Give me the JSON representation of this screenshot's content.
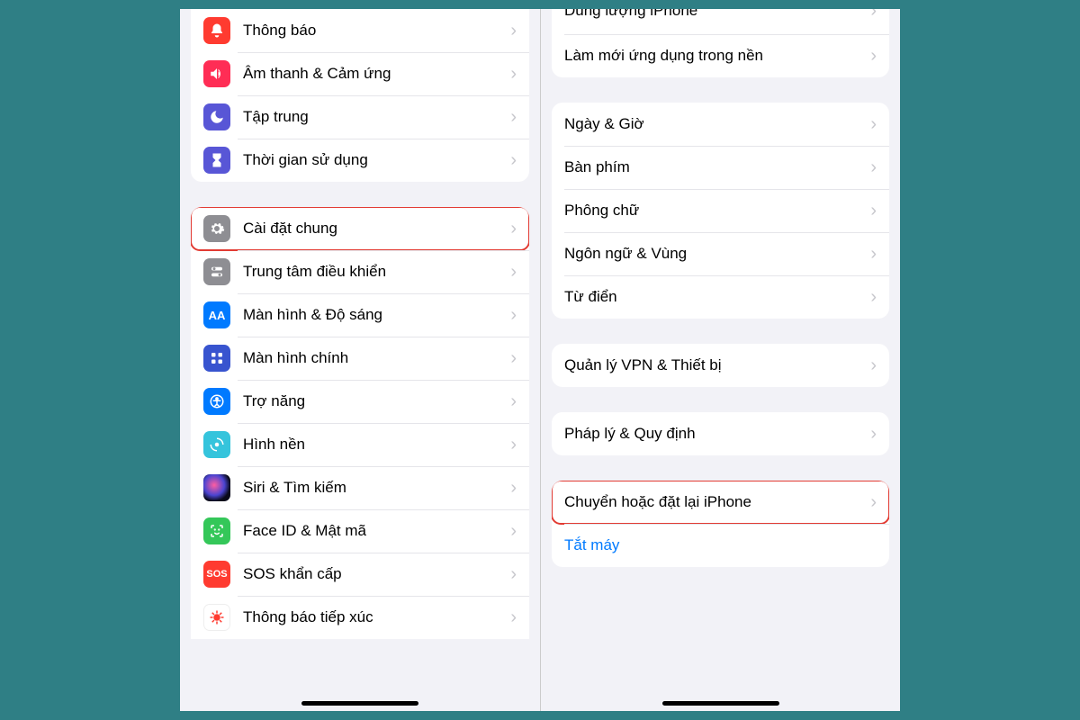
{
  "left": {
    "group1": [
      {
        "id": "notifications",
        "label": "Thông báo",
        "icon": "bell",
        "color": "#ff3b30"
      },
      {
        "id": "sounds",
        "label": "Âm thanh & Cảm ứng",
        "icon": "sound",
        "color": "#ff2d55"
      },
      {
        "id": "focus",
        "label": "Tập trung",
        "icon": "moon",
        "color": "#5856d6"
      },
      {
        "id": "screentime",
        "label": "Thời gian sử dụng",
        "icon": "hourglass",
        "color": "#5856d6"
      }
    ],
    "group2": [
      {
        "id": "general",
        "label": "Cài đặt chung",
        "icon": "gear",
        "color": "#8e8e93",
        "highlight": true
      },
      {
        "id": "control-center",
        "label": "Trung tâm điều khiển",
        "icon": "toggles",
        "color": "#8e8e93"
      },
      {
        "id": "display",
        "label": "Màn hình & Độ sáng",
        "icon": "aa",
        "color": "#007aff"
      },
      {
        "id": "home-screen",
        "label": "Màn hình chính",
        "icon": "grid",
        "color": "#3854cf"
      },
      {
        "id": "accessibility",
        "label": "Trợ năng",
        "icon": "access",
        "color": "#007aff"
      },
      {
        "id": "wallpaper",
        "label": "Hình nền",
        "icon": "wallpaper",
        "color": "#35c4dc"
      },
      {
        "id": "siri",
        "label": "Siri & Tìm kiếm",
        "icon": "siri",
        "color": "#000"
      },
      {
        "id": "faceid",
        "label": "Face ID & Mật mã",
        "icon": "face",
        "color": "#34c759"
      },
      {
        "id": "sos",
        "label": "SOS khẩn cấp",
        "icon": "sos",
        "color": "#ff3b30"
      },
      {
        "id": "exposure",
        "label": "Thông báo tiếp xúc",
        "icon": "covid",
        "color": "#fff"
      }
    ]
  },
  "right": {
    "truncated_top": "Dung lượng iPhone",
    "group1": [
      {
        "id": "bg-refresh",
        "label": "Làm mới ứng dụng trong nền"
      }
    ],
    "group2": [
      {
        "id": "date-time",
        "label": "Ngày & Giờ"
      },
      {
        "id": "keyboard",
        "label": "Bàn phím"
      },
      {
        "id": "fonts",
        "label": "Phông chữ"
      },
      {
        "id": "language",
        "label": "Ngôn ngữ & Vùng"
      },
      {
        "id": "dictionary",
        "label": "Từ điển"
      }
    ],
    "group3": [
      {
        "id": "vpn",
        "label": "Quản lý VPN & Thiết bị"
      }
    ],
    "group4": [
      {
        "id": "legal",
        "label": "Pháp lý & Quy định"
      }
    ],
    "group5": [
      {
        "id": "transfer-reset",
        "label": "Chuyển hoặc đặt lại iPhone",
        "highlight": true
      },
      {
        "id": "shutdown",
        "label": "Tắt máy",
        "link": true,
        "noChevron": true
      }
    ]
  },
  "icons_text": {
    "aa": "AA",
    "sos": "SOS"
  }
}
